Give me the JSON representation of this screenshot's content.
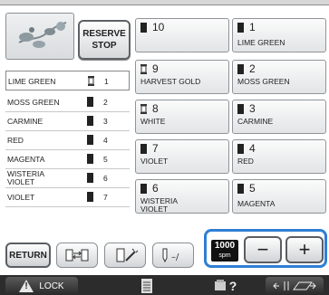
{
  "reserve_stop_label": "RESERVE\nSTOP",
  "thread_list": [
    {
      "name": "LIME GREEN",
      "number": "1",
      "selected": true
    },
    {
      "name": "MOSS GREEN",
      "number": "2"
    },
    {
      "name": "CARMINE",
      "number": "3"
    },
    {
      "name": "RED",
      "number": "4"
    },
    {
      "name": "MAGENTA",
      "number": "5"
    },
    {
      "name": "WISTERIA\nVIOLET",
      "number": "6"
    },
    {
      "name": "VIOLET",
      "number": "7"
    }
  ],
  "needles": [
    {
      "number": "10",
      "color": "",
      "spool": "dark"
    },
    {
      "number": "1",
      "color": "LIME GREEN",
      "spool": "dark"
    },
    {
      "number": "9",
      "color": "HARVEST GOLD",
      "spool": "light"
    },
    {
      "number": "2",
      "color": "MOSS GREEN",
      "spool": "dark"
    },
    {
      "number": "8",
      "color": "WHITE",
      "spool": "light"
    },
    {
      "number": "3",
      "color": "CARMINE",
      "spool": "dark"
    },
    {
      "number": "7",
      "color": "VIOLET",
      "spool": "dark"
    },
    {
      "number": "4",
      "color": "RED",
      "spool": "dark"
    },
    {
      "number": "6",
      "color": "WISTERIA\nVIOLET",
      "spool": "dark"
    },
    {
      "number": "5",
      "color": "MAGENTA",
      "spool": "dark"
    }
  ],
  "return_label": "RETURN",
  "speed": {
    "value": "1000",
    "unit": "spm",
    "minus": "−",
    "plus": "+"
  },
  "lock_label": "LOCK",
  "help_label": "?",
  "colors": {
    "accent": "#2f7fd4",
    "statusbar": "#2c2c2c"
  }
}
